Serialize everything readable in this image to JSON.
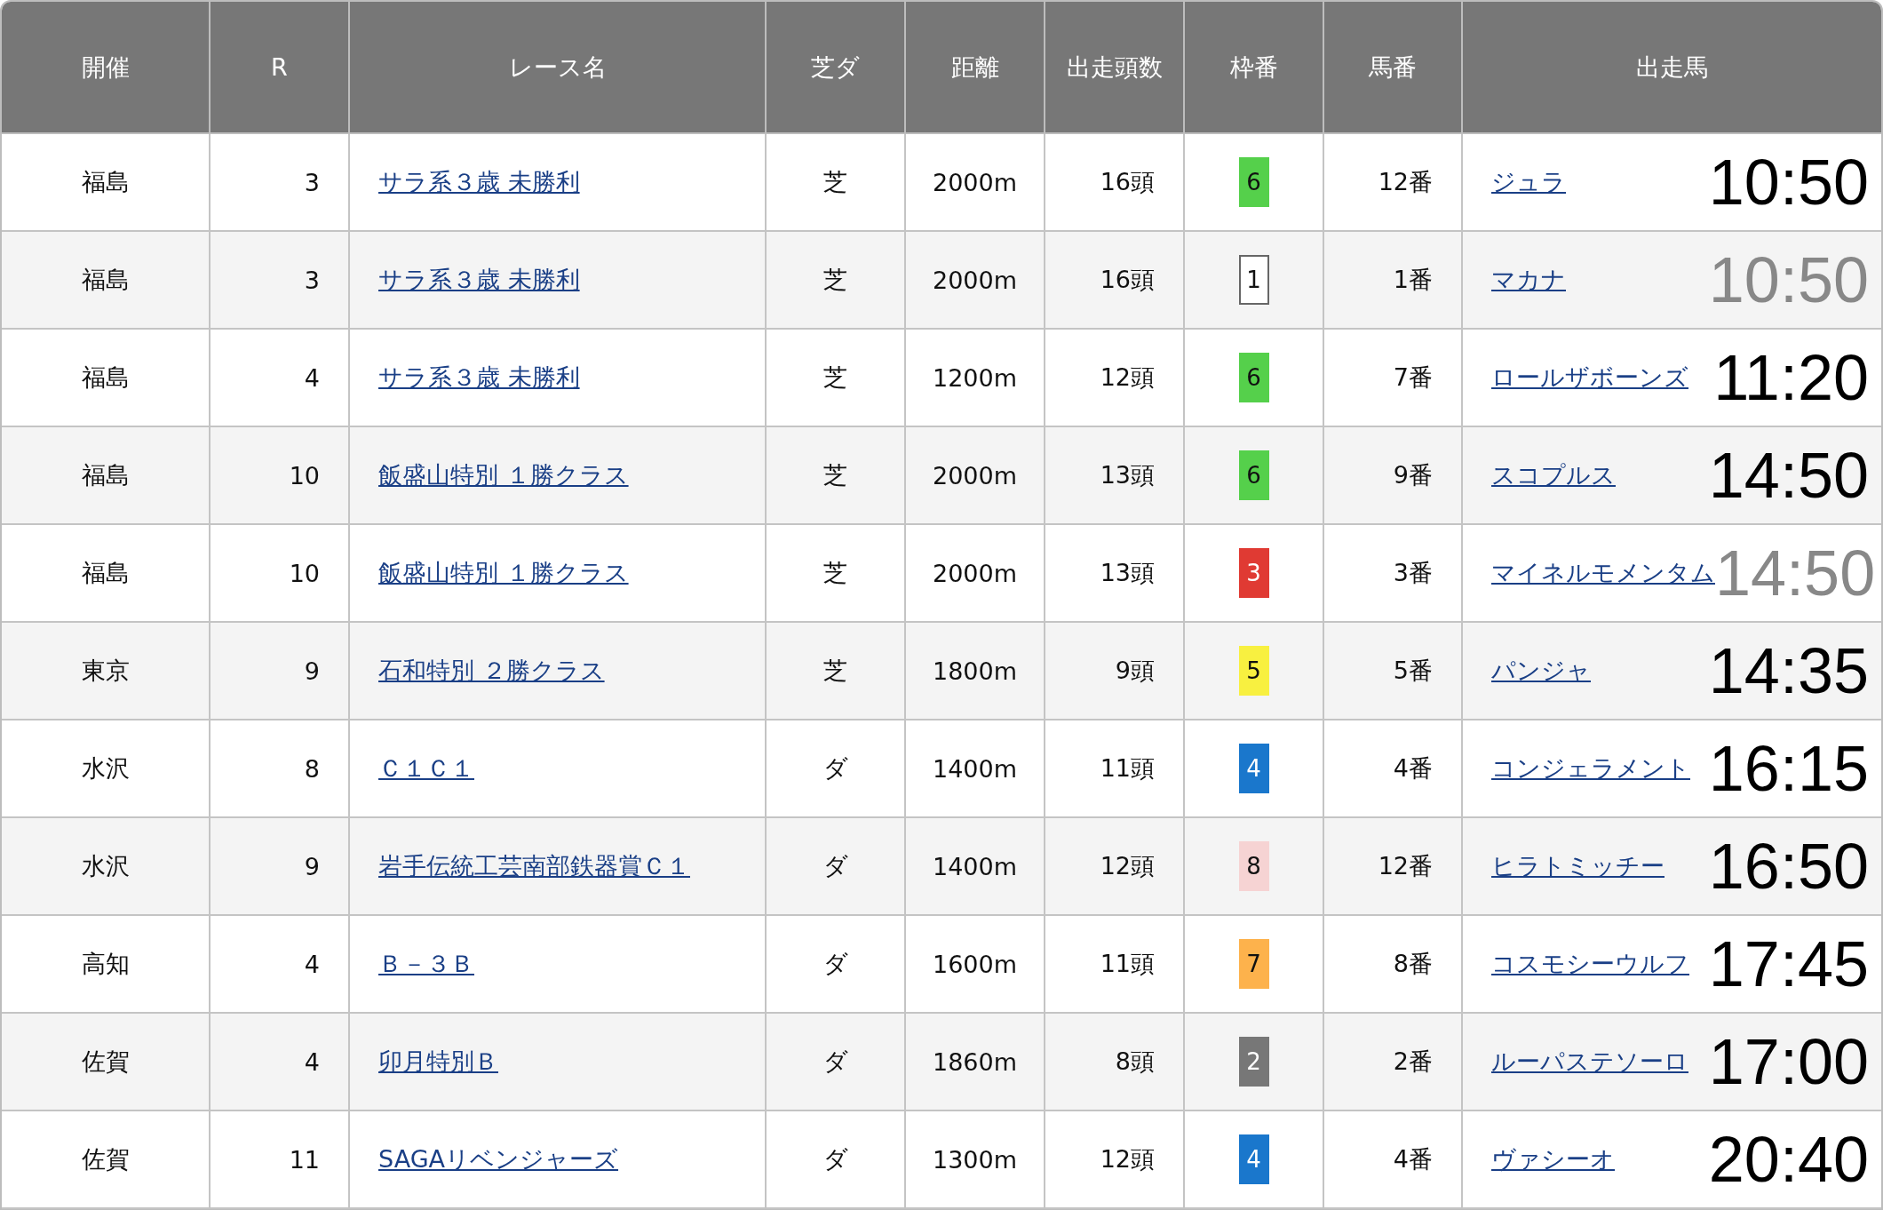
{
  "table": {
    "columns": [
      "開催",
      "R",
      "レース名",
      "芝ダ",
      "距離",
      "出走頭数",
      "枠番",
      "馬番",
      "出走馬"
    ],
    "rows": [
      {
        "venue": "福島",
        "race": "3",
        "race_name": "サラ系３歳 未勝利",
        "surface": "芝",
        "distance": "2000m",
        "runners": "16頭",
        "frame": "6",
        "color": "#55d04b",
        "number": "12番",
        "horse": "ジュラ",
        "time": "10:50",
        "dimmed": false
      },
      {
        "venue": "福島",
        "race": "3",
        "race_name": "サラ系３歳 未勝利",
        "surface": "芝",
        "distance": "2000m",
        "runners": "16頭",
        "frame": "1",
        "color": "#ffffff",
        "number": "1番",
        "horse": "マカナ",
        "time": "10:50",
        "dimmed": true
      },
      {
        "venue": "福島",
        "race": "4",
        "race_name": "サラ系３歳 未勝利",
        "surface": "芝",
        "distance": "1200m",
        "runners": "12頭",
        "frame": "6",
        "color": "#55d04b",
        "number": "7番",
        "horse": "ロールザボーンズ",
        "time": "11:20",
        "dimmed": false
      },
      {
        "venue": "福島",
        "race": "10",
        "race_name": "飯盛山特別 １勝クラス",
        "surface": "芝",
        "distance": "2000m",
        "runners": "13頭",
        "frame": "6",
        "color": "#55d04b",
        "number": "9番",
        "horse": "スコプルス",
        "time": "14:50",
        "dimmed": false
      },
      {
        "venue": "福島",
        "race": "10",
        "race_name": "飯盛山特別 １勝クラス",
        "surface": "芝",
        "distance": "2000m",
        "runners": "13頭",
        "frame": "3",
        "color": "#e03a33",
        "number": "3番",
        "horse": "マイネルモメンタム",
        "time": "14:50",
        "dimmed": true
      },
      {
        "venue": "東京",
        "race": "9",
        "race_name": "石和特別 ２勝クラス",
        "surface": "芝",
        "distance": "1800m",
        "runners": "9頭",
        "frame": "5",
        "color": "#f8f040",
        "number": "5番",
        "horse": "パンジャ",
        "time": "14:35",
        "dimmed": false
      },
      {
        "venue": "水沢",
        "race": "8",
        "race_name": "Ｃ１Ｃ１",
        "surface": "ダ",
        "distance": "1400m",
        "runners": "11頭",
        "frame": "4",
        "color": "#1a77cc",
        "number": "4番",
        "horse": "コンジェラメント",
        "time": "16:15",
        "dimmed": false
      },
      {
        "venue": "水沢",
        "race": "9",
        "race_name": "岩手伝統工芸南部鉄器賞Ｃ１",
        "surface": "ダ",
        "distance": "1400m",
        "runners": "12頭",
        "frame": "8",
        "color": "#f6d3d3",
        "number": "12番",
        "horse": "ヒラトミッチー",
        "time": "16:50",
        "dimmed": false
      },
      {
        "venue": "高知",
        "race": "4",
        "race_name": "Ｂ－３Ｂ",
        "surface": "ダ",
        "distance": "1600m",
        "runners": "11頭",
        "frame": "7",
        "color": "#fdb24c",
        "number": "8番",
        "horse": "コスモシーウルフ",
        "time": "17:45",
        "dimmed": false
      },
      {
        "venue": "佐賀",
        "race": "4",
        "race_name": "卯月特別Ｂ",
        "surface": "ダ",
        "distance": "1860m",
        "runners": "8頭",
        "frame": "2",
        "color": "#777777",
        "number": "2番",
        "horse": "ルーパステソーロ",
        "time": "17:00",
        "dimmed": false
      },
      {
        "venue": "佐賀",
        "race": "11",
        "race_name": "SAGAリベンジャーズ",
        "surface": "ダ",
        "distance": "1300m",
        "runners": "12頭",
        "frame": "4",
        "color": "#1a77cc",
        "number": "4番",
        "horse": "ヴァシーオ",
        "time": "20:40",
        "dimmed": false
      }
    ]
  }
}
